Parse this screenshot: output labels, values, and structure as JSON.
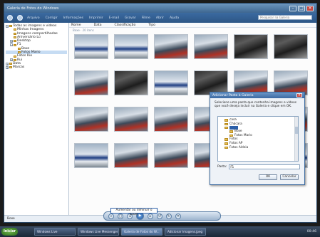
{
  "window": {
    "title": "Galeria de Fotos do Windows"
  },
  "toolbar": {
    "items": [
      "Arquivo",
      "Corrigir",
      "Informações",
      "Imprimir",
      "E-mail",
      "Gravar",
      "Filme",
      "Abrir",
      "Ajuda"
    ]
  },
  "search": {
    "placeholder": "Pesquisar na Galeria"
  },
  "nav": {
    "items": [
      {
        "label": "Todas as imagens e vídeos",
        "indent": 0,
        "exp": "−"
      },
      {
        "label": "Minhas Imagens",
        "indent": 1,
        "exp": ""
      },
      {
        "label": "Imagens compartilhadas",
        "indent": 1,
        "exp": ""
      },
      {
        "label": "Aniversário Lú",
        "indent": 1,
        "exp": ""
      },
      {
        "label": "Desktop",
        "indent": 1,
        "exp": "+"
      },
      {
        "label": "F1",
        "indent": 1,
        "exp": "−"
      },
      {
        "label": "Boxe",
        "indent": 2,
        "exp": ""
      },
      {
        "label": "Fotos Mario",
        "indent": 2,
        "exp": ""
      },
      {
        "label": "Fotos Rio",
        "indent": 1,
        "exp": ""
      },
      {
        "label": "Rui",
        "indent": 1,
        "exp": "+"
      },
      {
        "label": "Data",
        "indent": 0,
        "exp": "+"
      },
      {
        "label": "Marcas",
        "indent": 0,
        "exp": "+"
      }
    ]
  },
  "columns": [
    "Nome",
    "Data",
    "Classificação",
    "Tipo"
  ],
  "group_label": "Boxe · 20 itens",
  "dialog": {
    "title": "Adicionar Pasta à Galeria",
    "message": "Selecione uma pasta que contenha imagens e vídeos que você deseja incluir na Galeria e clique em OK.",
    "folders": [
      {
        "label": "casa",
        "indent": 1,
        "selected": false
      },
      {
        "label": "Chácara",
        "indent": 1,
        "selected": false
      },
      {
        "label": "",
        "indent": 1,
        "selected": true
      },
      {
        "label": "Boxe",
        "indent": 2,
        "selected": false
      },
      {
        "label": "Fotos Mario",
        "indent": 2,
        "selected": false
      },
      {
        "label": "Fotos",
        "indent": 1,
        "selected": false
      },
      {
        "label": "Fotos AP",
        "indent": 1,
        "selected": false
      },
      {
        "label": "Fotos Aldeia",
        "indent": 1,
        "selected": false
      }
    ],
    "pasta_label": "Pasta:",
    "pasta_value": "F1",
    "ok_label": "OK",
    "cancel_label": "Cancelar"
  },
  "status": {
    "text": "Boxe"
  },
  "controls": {
    "tooltip": "Aumentar ou diminuir o zoom"
  },
  "taskbar": {
    "start_label": "Iniciar",
    "tasks": [
      {
        "label": "Windows Live",
        "active": false
      },
      {
        "label": "Windows Live Messenger",
        "active": false
      },
      {
        "label": "Galeria de Fotos do W...",
        "active": true
      },
      {
        "label": "Adicionar Imagens.jpeg",
        "active": false
      }
    ],
    "clock": "00:46"
  },
  "thumbnails": [
    "car",
    "car",
    "crowd",
    "crowd",
    "tyres",
    "tyres",
    "crowd",
    "tyres",
    "car",
    "tyres",
    "crowd",
    "crowd",
    "crowd",
    "crowd",
    "crowd",
    "crowd",
    "crowd",
    "crowd",
    "car",
    "crowd",
    "crowd",
    "crowd",
    "car",
    "car"
  ]
}
